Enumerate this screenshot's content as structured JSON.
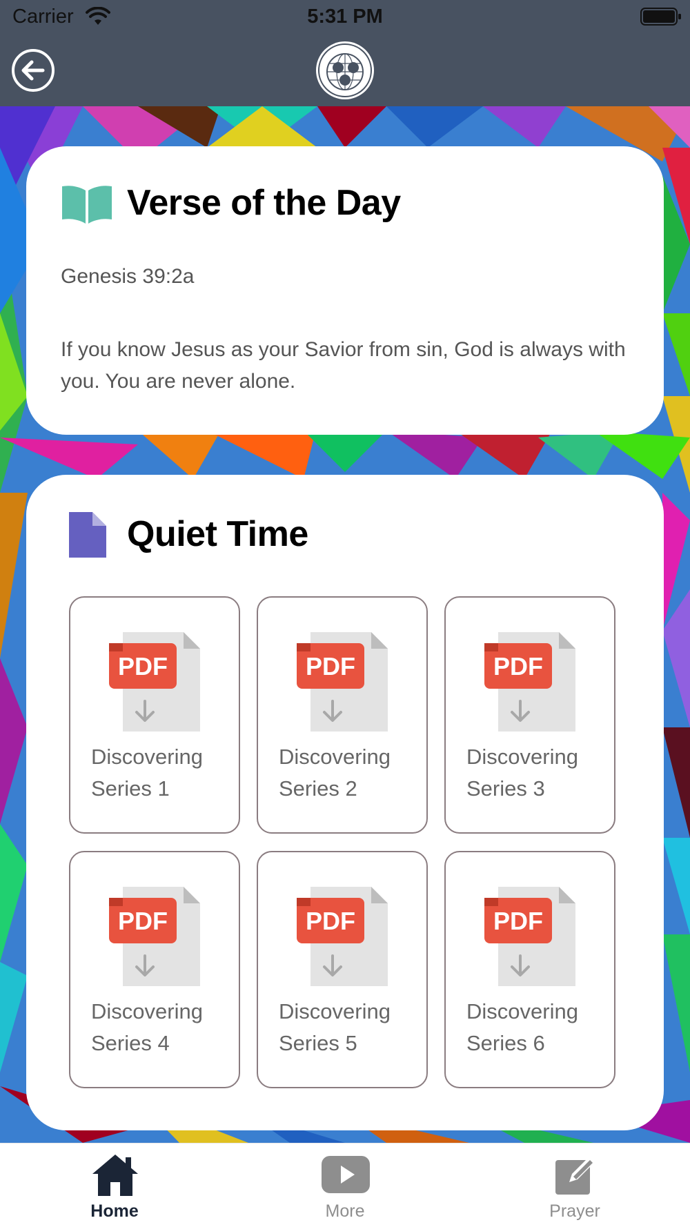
{
  "status_bar": {
    "carrier": "Carrier",
    "time": "5:31 PM"
  },
  "nav": {
    "back_icon": "back-arrow-circle-icon",
    "logo_icon": "globe-seal-logo"
  },
  "verse_card": {
    "title": "Verse of the Day",
    "icon": "open-book-icon",
    "reference": "Genesis 39:2a",
    "text": "If you know Jesus as your Savior from sin, God is always with you. You are never alone."
  },
  "quiet_time": {
    "title": "Quiet Time",
    "icon": "document-icon",
    "pdf_badge": "PDF",
    "items": [
      {
        "line1": "Discovering",
        "line2": "Series 1"
      },
      {
        "line1": "Discovering",
        "line2": "Series 2"
      },
      {
        "line1": "Discovering",
        "line2": "Series 3"
      },
      {
        "line1": "Discovering",
        "line2": "Series 4"
      },
      {
        "line1": "Discovering",
        "line2": "Series 5"
      },
      {
        "line1": "Discovering",
        "line2": "Series 6"
      }
    ]
  },
  "tabs": [
    {
      "label": "Home",
      "icon": "home-icon",
      "active": true
    },
    {
      "label": "More",
      "icon": "play-icon",
      "active": false
    },
    {
      "label": "Prayer",
      "icon": "edit-icon",
      "active": false
    }
  ],
  "colors": {
    "header": "#485261",
    "accent_active": "#1b2536",
    "inactive": "#8e8e8e",
    "book_icon": "#5cbfaa",
    "doc_icon": "#6560c0",
    "pdf_red": "#e8533f"
  }
}
